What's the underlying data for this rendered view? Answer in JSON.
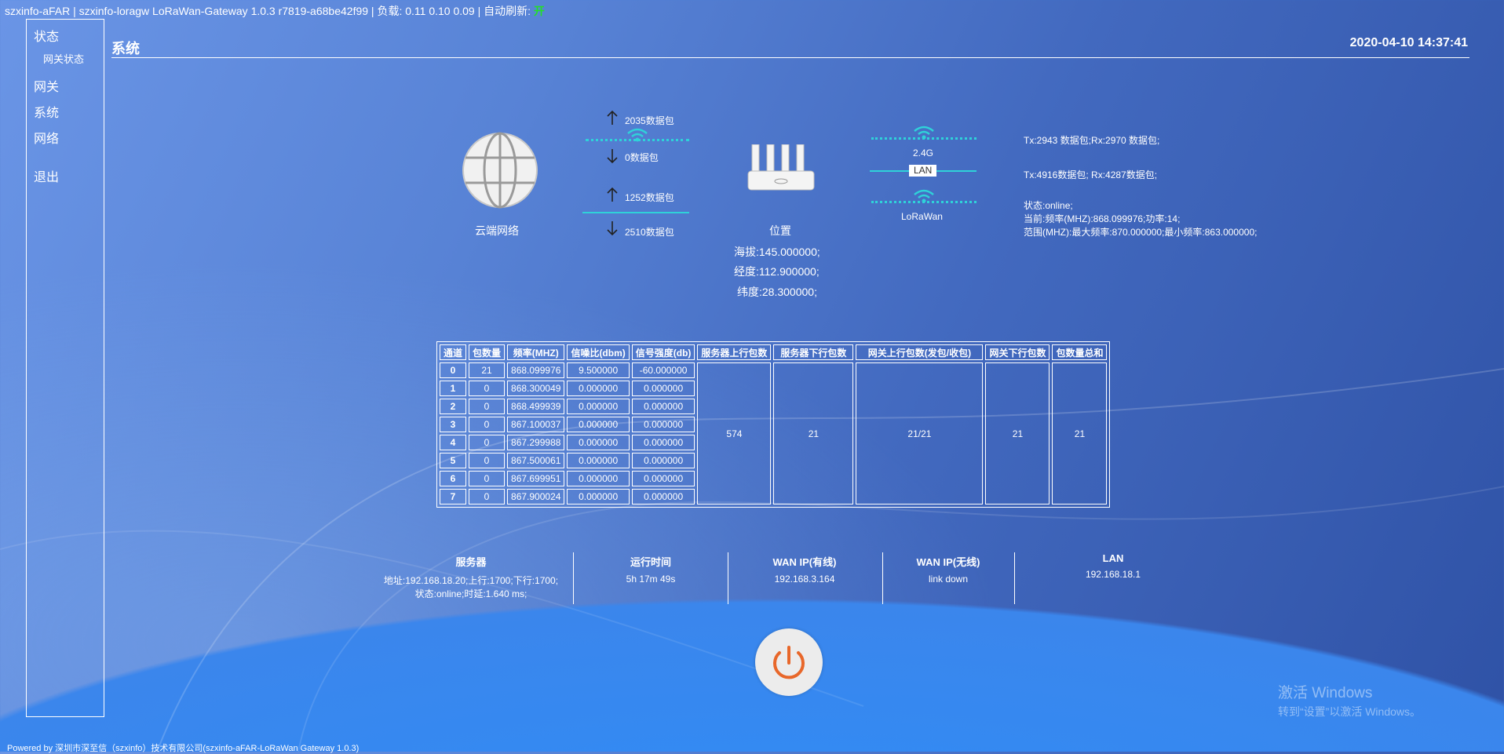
{
  "topbar": {
    "text": "szxinfo-aFAR | szxinfo-loragw LoRaWan-Gateway 1.0.3 r7819-a68be42f99 | 负载: 0.11 0.10 0.09 | 自动刷新: ",
    "refresh_state": "开"
  },
  "sidebar": {
    "status": "状态",
    "gateway_status": "网关状态",
    "gateway": "网关",
    "system": "系统",
    "network": "网络",
    "logout": "退出"
  },
  "header": {
    "title": "系统",
    "datetime": "2020-04-10 14:37:41"
  },
  "topology": {
    "cloud_label": "云端网络",
    "up1": "2035",
    "down1": "0",
    "up2": "1252",
    "down2": "2510",
    "pkt_unit": "数据包",
    "position_label": "位置",
    "altitude": "海拔:145.000000;",
    "longitude": "经度:112.900000;",
    "latitude": "纬度:28.300000;",
    "wifi_label": "2.4G",
    "lan_label": "LAN",
    "lora_label": "LoRaWan",
    "tx_rx_wifi": "Tx:2943 数据包;Rx:2970 数据包;",
    "tx_rx_lan": "Tx:4916数据包; Rx:4287数据包;",
    "lora_status": "状态:online;",
    "lora_current": "当前:频率(MHZ):868.099976;功率:14;",
    "lora_range": "范围(MHZ):最大频率:870.000000;最小频率:863.000000;"
  },
  "channels": {
    "headers": [
      "通道",
      "包数量",
      "频率(MHZ)",
      "信噪比(dbm)",
      "信号强度(db)",
      "服务器上行包数",
      "服务器下行包数",
      "网关上行包数(发包/收包)",
      "网关下行包数",
      "包数量总和"
    ],
    "rows": [
      [
        "0",
        "21",
        "868.099976",
        "9.500000",
        "-60.000000"
      ],
      [
        "1",
        "0",
        "868.300049",
        "0.000000",
        "0.000000"
      ],
      [
        "2",
        "0",
        "868.499939",
        "0.000000",
        "0.000000"
      ],
      [
        "3",
        "0",
        "867.100037",
        "0.000000",
        "0.000000"
      ],
      [
        "4",
        "0",
        "867.299988",
        "0.000000",
        "0.000000"
      ],
      [
        "5",
        "0",
        "867.500061",
        "0.000000",
        "0.000000"
      ],
      [
        "6",
        "0",
        "867.699951",
        "0.000000",
        "0.000000"
      ],
      [
        "7",
        "0",
        "867.900024",
        "0.000000",
        "0.000000"
      ]
    ],
    "server_up": "574",
    "server_down": "21",
    "gw_up": "21/21",
    "gw_down": "21",
    "total": "21"
  },
  "info": {
    "server_title": "服务器",
    "server_line1": "地址:192.168.18.20;上行:1700;下行:1700;",
    "server_line2": "状态:online;时延:1.640 ms;",
    "uptime_title": "运行时间",
    "uptime": "5h 17m 49s",
    "wan_wired_title": "WAN IP(有线)",
    "wan_wired": "192.168.3.164",
    "wan_wireless_title": "WAN IP(无线)",
    "wan_wireless": "link down",
    "lan_title": "LAN",
    "lan": "192.168.18.1"
  },
  "footer": {
    "text": "Powered by 深圳市深至信（szxinfo）技术有限公司(szxinfo-aFAR-LoRaWan Gateway 1.0.3)"
  },
  "watermark": {
    "line1": "激活 Windows",
    "line2": "转到“设置”以激活 Windows。"
  },
  "icons": {
    "cloud": "globe-icon",
    "router": "router-icon",
    "power": "power-icon",
    "wifi": "wifi-icon"
  },
  "colors": {
    "accent": "#2fd2d9",
    "power": "#e8672a",
    "refresh_on": "#22e027"
  }
}
